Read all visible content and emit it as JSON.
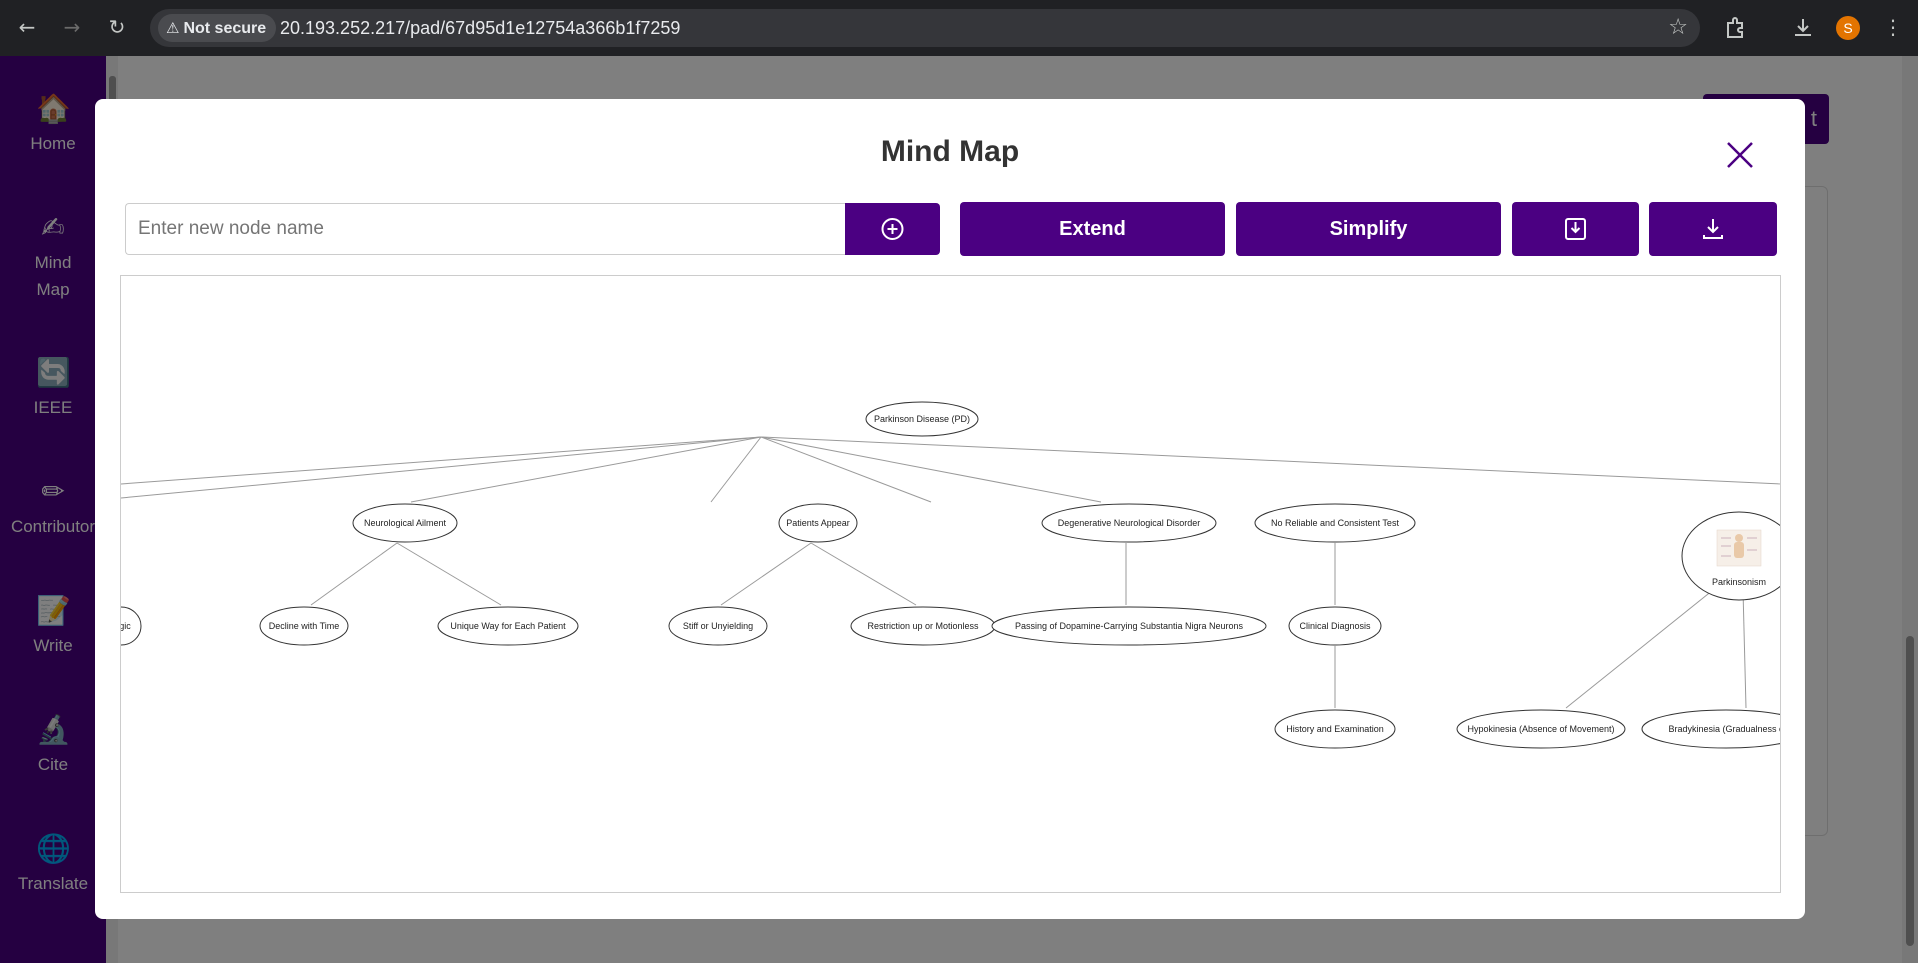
{
  "browser": {
    "security_label": "Not secure",
    "url": "20.193.252.217/pad/67d95d1e12754a366b1f7259",
    "profile_initial": "S"
  },
  "sidebar": {
    "items": [
      {
        "label": "Home",
        "icon": "home-icon"
      },
      {
        "label": "Mind Map",
        "icon": "mind-map-icon"
      },
      {
        "label": "IEEE",
        "icon": "ieee-icon"
      },
      {
        "label": "Contributor",
        "icon": "pencil-icon"
      },
      {
        "label": "Write",
        "icon": "write-icon"
      },
      {
        "label": "Cite",
        "icon": "microscope-icon"
      },
      {
        "label": "Translate",
        "icon": "globe-icon"
      }
    ]
  },
  "background": {
    "button_partial_label": "t"
  },
  "modal": {
    "title": "Mind Map",
    "input_placeholder": "Enter new node name",
    "input_value": "",
    "extend_label": "Extend",
    "simplify_label": "Simplify"
  },
  "colors": {
    "brand": "#4b0082",
    "edge": "#9a9a9a"
  },
  "mindmap": {
    "root": "Parkinson Disease (PD)",
    "nodes": [
      {
        "id": "root",
        "label": "Parkinson Disease (PD)"
      },
      {
        "id": "n1",
        "label": "Neurological Ailment",
        "parent": "root"
      },
      {
        "id": "n2",
        "label": "Patients Appear",
        "parent": "root"
      },
      {
        "id": "n3",
        "label": "Degenerative Neurological Disorder",
        "parent": "root"
      },
      {
        "id": "n4",
        "label": "No Reliable and Consistent Test",
        "parent": "root"
      },
      {
        "id": "n5",
        "label": "Parkinsonism",
        "parent": "root",
        "has_image": true
      },
      {
        "id": "c0",
        "label": "gic"
      },
      {
        "id": "c1",
        "label": "Decline with Time",
        "parent": "n1"
      },
      {
        "id": "c2",
        "label": "Unique Way for Each Patient",
        "parent": "n1"
      },
      {
        "id": "c3",
        "label": "Stiff or Unyielding",
        "parent": "n2"
      },
      {
        "id": "c4",
        "label": "Restriction up or Motionless",
        "parent": "n2"
      },
      {
        "id": "c5",
        "label": "Passing of Dopamine-Carrying Substantia Nigra Neurons",
        "parent": "n3"
      },
      {
        "id": "c6",
        "label": "Clinical Diagnosis",
        "parent": "n4"
      },
      {
        "id": "g1",
        "label": "History and Examination",
        "parent": "c6"
      },
      {
        "id": "g2",
        "label": "Hypokinesia (Absence of Movement)",
        "parent": "n5"
      },
      {
        "id": "g3",
        "label": "Bradykinesia (Gradualness of U",
        "parent": "n5"
      }
    ]
  }
}
